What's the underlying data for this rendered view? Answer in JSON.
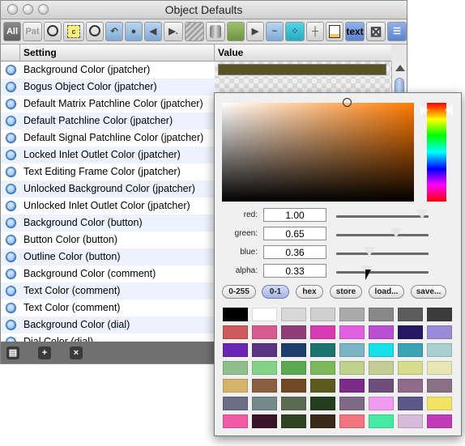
{
  "window": {
    "title": "Object Defaults"
  },
  "toolbar": {
    "all_label": "All",
    "pat_label": "Pat",
    "text_label": "text",
    "icons": [
      "circle-icon",
      "comment-icon",
      "dial-icon",
      "undo-icon",
      "mic-icon",
      "speaker-icon",
      "prompt-icon",
      "stripes-icon",
      "cylinder-icon",
      "patcher-icon",
      "play-icon",
      "wave-icon",
      "matrix-icon",
      "grid-icon",
      "panel-icon",
      "text-icon",
      "x-box-icon",
      "list-icon"
    ]
  },
  "table": {
    "headers": {
      "setting": "Setting",
      "value": "Value"
    },
    "rows": [
      {
        "label": "Background Color (jpatcher)",
        "swatch": "#5a5222"
      },
      {
        "label": "Bogus Object Color (jpatcher)"
      },
      {
        "label": "Default Matrix Patchline Color (jpatcher)"
      },
      {
        "label": "Default Patchline Color (jpatcher)"
      },
      {
        "label": "Default Signal Patchline Color (jpatcher)"
      },
      {
        "label": "Locked Inlet Outlet Color (jpatcher)"
      },
      {
        "label": "Text Editing Frame Color (jpatcher)"
      },
      {
        "label": "Unlocked Background Color (jpatcher)"
      },
      {
        "label": "Unlocked Inlet Outlet Color (jpatcher)"
      },
      {
        "label": "Background Color (button)"
      },
      {
        "label": "Button Color (button)"
      },
      {
        "label": "Outline Color (button)"
      },
      {
        "label": "Background Color (comment)"
      },
      {
        "label": "Text Color (comment)"
      },
      {
        "label": "Text Color (comment)"
      },
      {
        "label": "Background Color (dial)"
      },
      {
        "label": "Dial Color (dial)"
      }
    ]
  },
  "bottom_buttons": [
    "new-doc-icon",
    "add-icon",
    "delete-icon"
  ],
  "picker": {
    "params": [
      {
        "label": "red:",
        "value": "1.00",
        "level": 0.93
      },
      {
        "label": "green:",
        "value": "0.65",
        "level": 0.65
      },
      {
        "label": "blue:",
        "value": "0.36",
        "level": 0.36
      },
      {
        "label": "alpha:",
        "value": "0.33",
        "level": 0.33
      }
    ],
    "buttons": [
      "0-255",
      "0-1",
      "hex",
      "store",
      "load...",
      "save..."
    ],
    "active_button": "0-1",
    "palette": [
      [
        "#000000",
        "#ffffff",
        "#d8d8d8",
        "#d0d0d0",
        "#aaaaaa",
        "#888888",
        "#5c5c5c",
        "#3c3c3c"
      ],
      [
        "#cd5b5e",
        "#d65b8e",
        "#8e3f7a",
        "#d93bb2",
        "#e45fe0",
        "#b94fd3",
        "#261863",
        "#9a8ad8"
      ],
      [
        "#6a27b3",
        "#5a3381",
        "#1d3f6e",
        "#1c7370",
        "#7bb6c4",
        "#15e1e8",
        "#3aa4b6",
        "#a8d0d0"
      ],
      [
        "#8fbf8a",
        "#84d487",
        "#5aaa52",
        "#7cb95b",
        "#c0d28e",
        "#c3cd94",
        "#d8dd8a",
        "#e8e7b2"
      ],
      [
        "#d4b46b",
        "#8b6042",
        "#6f4a24",
        "#5d5a1b",
        "#7c2b88",
        "#6e4e7b",
        "#8f6a8a",
        "#8a7186"
      ],
      [
        "#6c6d86",
        "#748a8b",
        "#596b50",
        "#233e1d",
        "#7e6a86",
        "#ef9cf0",
        "#5c5786",
        "#f1e462"
      ],
      [
        "#f35aa5",
        "#3a1528",
        "#2f4221",
        "#3a2a18",
        "#f2747e",
        "#44eaa3",
        "#d4bcd8",
        "#c13ab9"
      ]
    ]
  }
}
